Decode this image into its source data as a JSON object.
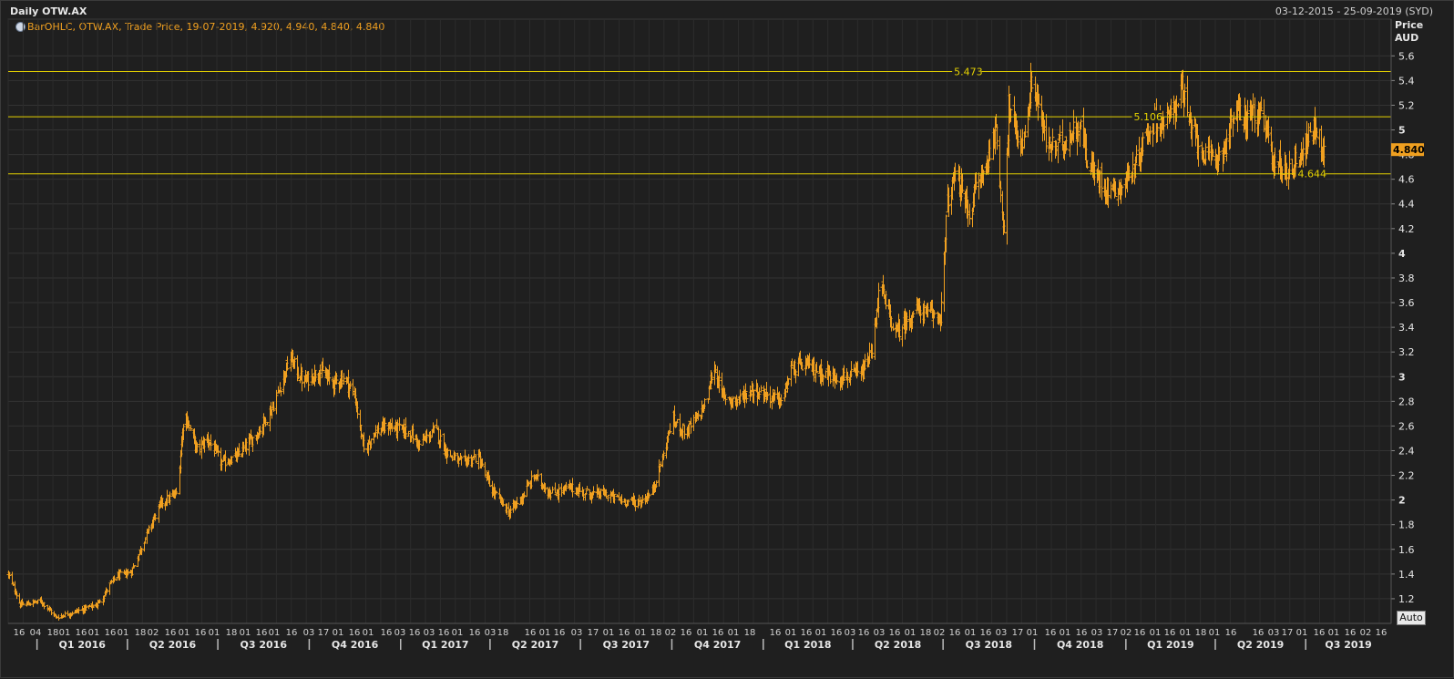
{
  "window": {
    "title": "Daily OTW.AX",
    "date_range": "03-12-2015 - 25-09-2019 (SYD)",
    "legend_text": "BarOHLC, OTW.AX, Trade Price, 19-07-2019, 4.920, 4.940, 4.840, 4.840",
    "axis_unit_line1": "Price",
    "axis_unit_line2": "AUD",
    "auto_button": "Auto"
  },
  "colors": {
    "background": "#1f1f1f",
    "grid": "#333333",
    "bars": "#f0a020",
    "levels": "#e6d200",
    "last_price_bg": "#f0a020"
  },
  "chart_data": {
    "type": "bar",
    "ohlc": true,
    "ylim": [
      1.0,
      5.75
    ],
    "y_ticks": [
      1.2,
      1.4,
      1.6,
      1.8,
      2,
      2.2,
      2.4,
      2.6,
      2.8,
      3,
      3.2,
      3.4,
      3.6,
      3.8,
      4,
      4.2,
      4.4,
      4.6,
      4.8,
      5,
      5.2,
      5.4,
      5.6
    ],
    "y_tick_labels": [
      "1.2",
      "1.4",
      "1.6",
      "1.8",
      "2",
      "2.2",
      "2.4",
      "2.6",
      "2.8",
      "3",
      "3.2",
      "3.4",
      "3.6",
      "3.8",
      "4",
      "4.2",
      "4.4",
      "4.6",
      "4.8",
      "5",
      "5.2",
      "5.4",
      "5.6"
    ],
    "x_start": "2015-12-03",
    "x_end": "2019-09-25",
    "last_price": 4.84,
    "last_price_label": "4.840",
    "levels": [
      {
        "value": 5.473,
        "label": "5.473",
        "label_date": "2018-07-12"
      },
      {
        "value": 5.106,
        "label": "5.106",
        "label_date": "2019-01-09"
      },
      {
        "value": 4.644,
        "label": "4.644",
        "label_date": "2019-06-23"
      }
    ],
    "quarter_labels": [
      {
        "label": "Q1 2016",
        "start": "2016-01-01"
      },
      {
        "label": "Q2 2016",
        "start": "2016-04-01"
      },
      {
        "label": "Q3 2016",
        "start": "2016-07-01"
      },
      {
        "label": "Q4 2016",
        "start": "2016-10-01"
      },
      {
        "label": "Q1 2017",
        "start": "2017-01-01"
      },
      {
        "label": "Q2 2017",
        "start": "2017-04-01"
      },
      {
        "label": "Q3 2017",
        "start": "2017-07-01"
      },
      {
        "label": "Q4 2017",
        "start": "2017-10-01"
      },
      {
        "label": "Q1 2018",
        "start": "2018-01-01"
      },
      {
        "label": "Q2 2018",
        "start": "2018-04-01"
      },
      {
        "label": "Q3 2018",
        "start": "2018-07-01"
      },
      {
        "label": "Q4 2018",
        "start": "2018-10-01"
      },
      {
        "label": "Q1 2019",
        "start": "2019-01-01"
      },
      {
        "label": "Q2 2019",
        "start": "2019-04-01"
      },
      {
        "label": "Q3 2019",
        "start": "2019-07-01"
      }
    ],
    "price_path": [
      [
        "2015-12-03",
        1.4
      ],
      [
        "2015-12-15",
        1.15
      ],
      [
        "2016-01-05",
        1.18
      ],
      [
        "2016-01-20",
        1.05
      ],
      [
        "2016-02-10",
        1.1
      ],
      [
        "2016-03-01",
        1.15
      ],
      [
        "2016-03-20",
        1.38
      ],
      [
        "2016-04-05",
        1.42
      ],
      [
        "2016-04-20",
        1.72
      ],
      [
        "2016-05-05",
        1.98
      ],
      [
        "2016-05-20",
        2.05
      ],
      [
        "2016-05-28",
        2.72
      ],
      [
        "2016-06-10",
        2.4
      ],
      [
        "2016-06-20",
        2.5
      ],
      [
        "2016-07-05",
        2.3
      ],
      [
        "2016-07-20",
        2.35
      ],
      [
        "2016-08-10",
        2.55
      ],
      [
        "2016-08-25",
        2.75
      ],
      [
        "2016-09-05",
        3.0
      ],
      [
        "2016-09-12",
        3.15
      ],
      [
        "2016-09-25",
        2.95
      ],
      [
        "2016-10-10",
        3.05
      ],
      [
        "2016-10-25",
        2.95
      ],
      [
        "2016-11-05",
        3.0
      ],
      [
        "2016-11-15",
        2.85
      ],
      [
        "2016-11-25",
        2.4
      ],
      [
        "2016-12-05",
        2.55
      ],
      [
        "2016-12-20",
        2.6
      ],
      [
        "2017-01-10",
        2.55
      ],
      [
        "2017-01-20",
        2.45
      ],
      [
        "2017-02-05",
        2.58
      ],
      [
        "2017-02-15",
        2.4
      ],
      [
        "2017-03-01",
        2.3
      ],
      [
        "2017-03-20",
        2.35
      ],
      [
        "2017-04-01",
        2.1
      ],
      [
        "2017-04-20",
        1.9
      ],
      [
        "2017-05-05",
        2.05
      ],
      [
        "2017-05-15",
        2.2
      ],
      [
        "2017-06-01",
        2.05
      ],
      [
        "2017-06-20",
        2.1
      ],
      [
        "2017-07-10",
        2.05
      ],
      [
        "2017-07-25",
        2.05
      ],
      [
        "2017-08-10",
        2.0
      ],
      [
        "2017-08-28",
        1.98
      ],
      [
        "2017-09-10",
        2.05
      ],
      [
        "2017-09-20",
        2.3
      ],
      [
        "2017-10-01",
        2.65
      ],
      [
        "2017-10-15",
        2.55
      ],
      [
        "2017-10-25",
        2.65
      ],
      [
        "2017-11-05",
        2.8
      ],
      [
        "2017-11-12",
        3.1
      ],
      [
        "2017-11-20",
        2.85
      ],
      [
        "2017-12-05",
        2.8
      ],
      [
        "2017-12-20",
        2.9
      ],
      [
        "2018-01-05",
        2.85
      ],
      [
        "2018-01-20",
        2.8
      ],
      [
        "2018-01-28",
        3.05
      ],
      [
        "2018-02-10",
        3.1
      ],
      [
        "2018-02-25",
        3.05
      ],
      [
        "2018-03-10",
        3.0
      ],
      [
        "2018-03-25",
        3.0
      ],
      [
        "2018-04-10",
        3.02
      ],
      [
        "2018-04-20",
        3.2
      ],
      [
        "2018-04-28",
        3.75
      ],
      [
        "2018-05-05",
        3.55
      ],
      [
        "2018-05-15",
        3.35
      ],
      [
        "2018-05-25",
        3.45
      ],
      [
        "2018-06-05",
        3.55
      ],
      [
        "2018-06-15",
        3.5
      ],
      [
        "2018-06-28",
        3.5
      ],
      [
        "2018-07-01",
        3.8
      ],
      [
        "2018-07-05",
        4.4
      ],
      [
        "2018-07-12",
        4.6
      ],
      [
        "2018-07-20",
        4.5
      ],
      [
        "2018-07-28",
        4.3
      ],
      [
        "2018-08-03",
        4.55
      ],
      [
        "2018-08-10",
        4.65
      ],
      [
        "2018-08-15",
        4.75
      ],
      [
        "2018-08-20",
        5.0
      ],
      [
        "2018-08-25",
        4.9
      ],
      [
        "2018-08-28",
        4.45
      ],
      [
        "2018-08-31",
        4.2
      ],
      [
        "2018-09-05",
        5.2
      ],
      [
        "2018-09-12",
        4.95
      ],
      [
        "2018-09-20",
        4.9
      ],
      [
        "2018-09-28",
        5.4
      ],
      [
        "2018-10-05",
        5.2
      ],
      [
        "2018-10-12",
        4.9
      ],
      [
        "2018-10-22",
        4.85
      ],
      [
        "2018-11-05",
        4.95
      ],
      [
        "2018-11-15",
        5.05
      ],
      [
        "2018-11-25",
        4.7
      ],
      [
        "2018-12-05",
        4.6
      ],
      [
        "2018-12-15",
        4.52
      ],
      [
        "2018-12-28",
        4.55
      ],
      [
        "2019-01-10",
        4.7
      ],
      [
        "2019-01-20",
        4.95
      ],
      [
        "2019-02-01",
        5.1
      ],
      [
        "2019-02-10",
        5.05
      ],
      [
        "2019-02-20",
        5.2
      ],
      [
        "2019-02-25",
        5.4
      ],
      [
        "2019-03-05",
        5.05
      ],
      [
        "2019-03-15",
        4.9
      ],
      [
        "2019-03-25",
        4.75
      ],
      [
        "2019-04-05",
        4.8
      ],
      [
        "2019-04-12",
        4.9
      ],
      [
        "2019-04-20",
        5.15
      ],
      [
        "2019-05-01",
        5.1
      ],
      [
        "2019-05-10",
        5.15
      ],
      [
        "2019-05-20",
        5.05
      ],
      [
        "2019-05-28",
        4.8
      ],
      [
        "2019-06-05",
        4.7
      ],
      [
        "2019-06-15",
        4.68
      ],
      [
        "2019-06-25",
        4.8
      ],
      [
        "2019-07-05",
        4.95
      ],
      [
        "2019-07-10",
        5.02
      ],
      [
        "2019-07-19",
        4.84
      ]
    ]
  },
  "x_axis": {
    "day_labels": [
      {
        "label": "16",
        "x": 20
      },
      {
        "label": "04",
        "x": 38
      },
      {
        "label": "18",
        "x": 57
      },
      {
        "label": "01",
        "x": 70
      },
      {
        "label": "16",
        "x": 88
      },
      {
        "label": "01",
        "x": 102
      },
      {
        "label": "16",
        "x": 120
      },
      {
        "label": "01",
        "x": 134
      },
      {
        "label": "18",
        "x": 153
      },
      {
        "label": "02",
        "x": 167
      },
      {
        "label": "16",
        "x": 186
      },
      {
        "label": "01",
        "x": 201
      },
      {
        "label": "16",
        "x": 219
      },
      {
        "label": "01",
        "x": 234
      },
      {
        "label": "18",
        "x": 253
      },
      {
        "label": "01",
        "x": 268
      },
      {
        "label": "16",
        "x": 286
      },
      {
        "label": "01",
        "x": 300
      },
      {
        "label": "16",
        "x": 319
      },
      {
        "label": "03",
        "x": 338
      },
      {
        "label": "17",
        "x": 354
      },
      {
        "label": "01",
        "x": 370
      },
      {
        "label": "16",
        "x": 388
      },
      {
        "label": "01",
        "x": 403
      },
      {
        "label": "16",
        "x": 423
      },
      {
        "label": "03",
        "x": 438
      },
      {
        "label": "16",
        "x": 454
      },
      {
        "label": "03",
        "x": 470
      },
      {
        "label": "16",
        "x": 486
      },
      {
        "label": "01",
        "x": 501
      },
      {
        "label": "16",
        "x": 520
      },
      {
        "label": "03",
        "x": 537
      },
      {
        "label": "18",
        "x": 551
      },
      {
        "label": "16",
        "x": 581
      },
      {
        "label": "01",
        "x": 597
      },
      {
        "label": "16",
        "x": 613
      },
      {
        "label": "03",
        "x": 632
      },
      {
        "label": "17",
        "x": 650
      },
      {
        "label": "01",
        "x": 667
      },
      {
        "label": "16",
        "x": 684
      },
      {
        "label": "01",
        "x": 702
      },
      {
        "label": "18",
        "x": 719
      },
      {
        "label": "02",
        "x": 735
      },
      {
        "label": "16",
        "x": 752
      },
      {
        "label": "01",
        "x": 770
      },
      {
        "label": "16",
        "x": 787
      },
      {
        "label": "01",
        "x": 804
      },
      {
        "label": "18",
        "x": 822
      },
      {
        "label": "16",
        "x": 850
      },
      {
        "label": "01",
        "x": 867
      },
      {
        "label": "16",
        "x": 884
      },
      {
        "label": "01",
        "x": 900
      },
      {
        "label": "16",
        "x": 917
      },
      {
        "label": "03",
        "x": 932
      },
      {
        "label": "16",
        "x": 947
      },
      {
        "label": "03",
        "x": 964
      },
      {
        "label": "16",
        "x": 981
      },
      {
        "label": "01",
        "x": 998
      },
      {
        "label": "18",
        "x": 1015
      },
      {
        "label": "02",
        "x": 1030
      },
      {
        "label": "16",
        "x": 1047
      },
      {
        "label": "01",
        "x": 1064
      },
      {
        "label": "16",
        "x": 1081
      },
      {
        "label": "03",
        "x": 1098
      },
      {
        "label": "17",
        "x": 1116
      },
      {
        "label": "01",
        "x": 1132
      },
      {
        "label": "16",
        "x": 1152
      },
      {
        "label": "01",
        "x": 1168
      },
      {
        "label": "16",
        "x": 1186
      },
      {
        "label": "03",
        "x": 1203
      },
      {
        "label": "17",
        "x": 1220
      },
      {
        "label": "02",
        "x": 1235
      },
      {
        "label": "16",
        "x": 1250
      },
      {
        "label": "01",
        "x": 1267
      },
      {
        "label": "16",
        "x": 1283
      },
      {
        "label": "01",
        "x": 1300
      },
      {
        "label": "18",
        "x": 1317
      },
      {
        "label": "01",
        "x": 1332
      },
      {
        "label": "16",
        "x": 1350
      },
      {
        "label": "16",
        "x": 1380
      },
      {
        "label": "03",
        "x": 1397
      },
      {
        "label": "17",
        "x": 1412
      },
      {
        "label": "01",
        "x": 1428
      },
      {
        "label": "16",
        "x": 1447
      },
      {
        "label": "01",
        "x": 1463
      },
      {
        "label": "16",
        "x": 1481
      },
      {
        "label": "02",
        "x": 1498
      },
      {
        "label": "16",
        "x": 1515
      }
    ]
  }
}
